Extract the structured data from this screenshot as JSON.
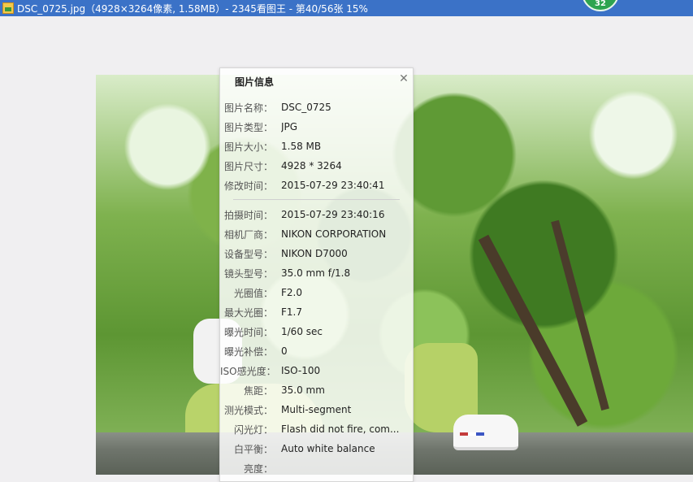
{
  "window": {
    "title": "DSC_0725.jpg（4928×3264像素, 1.58MB）- 2345看图王 - 第40/56张 15%",
    "badge": "32"
  },
  "info_panel": {
    "title": "图片信息",
    "close_icon": "close-icon",
    "file_rows": [
      {
        "label": "图片名称：",
        "value": "DSC_0725"
      },
      {
        "label": "图片类型：",
        "value": "JPG"
      },
      {
        "label": "图片大小：",
        "value": "1.58 MB"
      },
      {
        "label": "图片尺寸：",
        "value": "4928 * 3264"
      },
      {
        "label": "修改时间：",
        "value": "2015-07-29 23:40:41"
      }
    ],
    "exif_rows": [
      {
        "label": "拍摄时间：",
        "value": "2015-07-29 23:40:16"
      },
      {
        "label": "相机厂商：",
        "value": "NIKON CORPORATION"
      },
      {
        "label": "设备型号：",
        "value": "NIKON D7000"
      },
      {
        "label": "镜头型号：",
        "value": "35.0 mm f/1.8"
      },
      {
        "label": "光圈值：",
        "value": "F2.0"
      },
      {
        "label": "最大光圈：",
        "value": "F1.7"
      },
      {
        "label": "曝光时间：",
        "value": "1/60 sec"
      },
      {
        "label": "曝光补偿：",
        "value": "0"
      },
      {
        "label": "ISO感光度：",
        "value": "ISO-100"
      },
      {
        "label": "焦距：",
        "value": "35.0 mm"
      },
      {
        "label": "测光模式：",
        "value": "Multi-segment"
      },
      {
        "label": "闪光灯：",
        "value": "Flash did not fire, com..."
      },
      {
        "label": "白平衡：",
        "value": "Auto white balance"
      },
      {
        "label": "亮度：",
        "value": ""
      }
    ]
  }
}
